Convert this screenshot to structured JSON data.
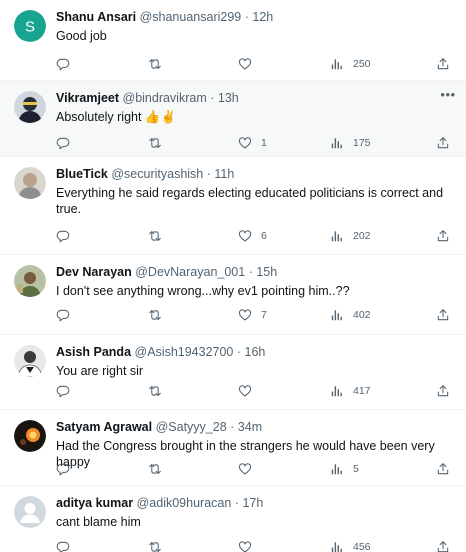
{
  "colors": {
    "text": "#0f1419",
    "secondary": "#536471",
    "divider": "#eff3f4",
    "highlight": "#f7f9f9"
  },
  "icons": {
    "reply": "reply-icon",
    "retweet": "retweet-icon",
    "like": "like-icon",
    "views": "views-icon",
    "share": "share-icon",
    "more": "more-icon"
  },
  "tweets": [
    {
      "name": "Shanu Ansari",
      "handle": "@shanuansari299",
      "sep": "·",
      "time": "12h",
      "text": "Good job",
      "likes": "",
      "views": "250",
      "avatar_letter": "S",
      "avatar_color": "#17a58f"
    },
    {
      "name": "Vikramjeet",
      "handle": "@bindravikram",
      "sep": "·",
      "time": "13h",
      "text": "Absolutely right 👍✌️",
      "likes": "1",
      "views": "175"
    },
    {
      "name": "BlueTick",
      "handle": "@securityashish",
      "sep": "·",
      "time": "11h",
      "text": "Everything he said regards electing educated politicians is correct and true.",
      "likes": "6",
      "views": "202"
    },
    {
      "name": "Dev Narayan",
      "handle": "@DevNarayan_001",
      "sep": "·",
      "time": "15h",
      "text": "I don't see anything wrong...why ev1 pointing him..??",
      "likes": "7",
      "views": "402"
    },
    {
      "name": "Asish Panda",
      "handle": "@Asish19432700",
      "sep": "·",
      "time": "16h",
      "text": "You are right sir",
      "likes": "",
      "views": "417"
    },
    {
      "name": "Satyam Agrawal",
      "handle": "@Satyyy_28",
      "sep": "·",
      "time": "34m",
      "text": "Had the Congress brought in the strangers he would have been very happy",
      "likes": "",
      "views": "5"
    },
    {
      "name": "aditya kumar",
      "handle": "@adik09huracan",
      "sep": "·",
      "time": "17h",
      "text": "cant blame him",
      "likes": "",
      "views": "456"
    }
  ]
}
